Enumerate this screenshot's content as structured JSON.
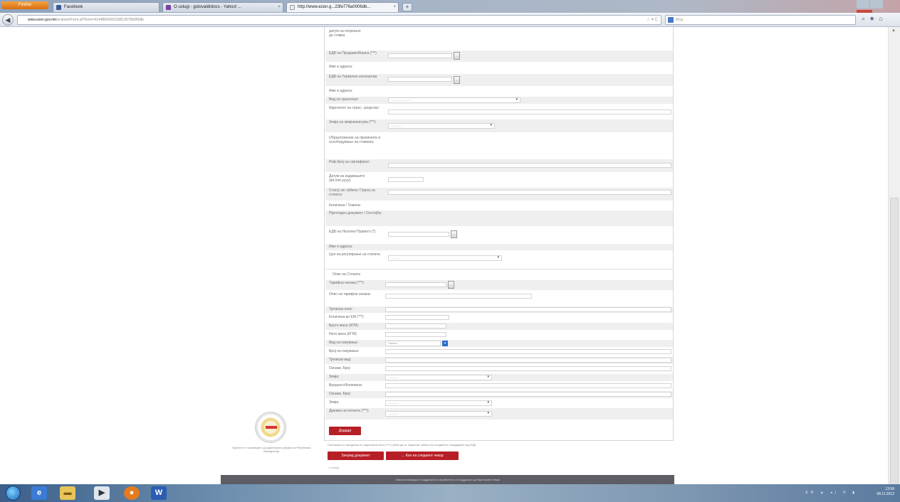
{
  "browser": {
    "menu_button": "Firefox",
    "tabs": [
      {
        "title": "Facebook",
        "active": false
      },
      {
        "title": "О uslugi - gotovaldrdocs - Yahoo! ...",
        "active": false
      },
      {
        "title": "http://www.ezen.g...23fe776a0006db...",
        "active": true
      }
    ],
    "new_tab": "+",
    "url_domain": "www.ezen.gov.mk",
    "url_path": "/ecitizen/Form.jsf?form=4144884266159813675b000db",
    "search_placeholder": "Bing"
  },
  "form": {
    "top_fragment": "датум на погрешно\nдо ставка",
    "rows": [
      {
        "label": "ЕДБ на Продавач/Банка (***)",
        "type": "lookup"
      },
      {
        "label": "Име и адреса:",
        "type": "static"
      },
      {
        "label": "ЕДБ на Термичко носилштва",
        "type": "lookup"
      },
      {
        "label": "Име и адреса:",
        "type": "static"
      },
      {
        "label": "Вид на транспорт:",
        "type": "select",
        "value": "----------------------"
      },
      {
        "label": "Идентитет на транс. средство:",
        "type": "text"
      },
      {
        "label": "Земја на земјоизнесува (***):",
        "type": "select",
        "value": "-----------"
      },
      {
        "label": "Образложение на промените и ослободување на ставката",
        "type": "static"
      },
      {
        "label": "Реф.број на сертификат:",
        "type": "text"
      },
      {
        "label": "Датум на издавањето (dd.mm.yyyy):",
        "type": "text"
      },
      {
        "label": "Статус во табела / Грана на стоката:",
        "type": "text"
      },
      {
        "label": "Количина / Тежина:",
        "type": "static"
      },
      {
        "label": "Претходен документ / Состојба:",
        "type": "static"
      },
      {
        "label": "ЕДБ на Носител Правото (*):",
        "type": "lookup"
      },
      {
        "label": "Име и адреса:",
        "type": "static"
      },
      {
        "label": "Цел на регулирање на стоката:",
        "type": "select",
        "value": "---------"
      }
    ],
    "section2_title": "Опис на Стоката",
    "rows2": [
      {
        "label": "Тарифна ознака (***):",
        "type": "lookup"
      },
      {
        "label": "Опис на тарифна ознака:",
        "type": "text"
      },
      {
        "label": "Трговски опис:",
        "type": "text"
      },
      {
        "label": "Количина во ЕМ (***):",
        "type": "text"
      },
      {
        "label": "Бруто маса (КГМ):",
        "type": "text"
      },
      {
        "label": "Нето маса (КГМ):",
        "type": "text"
      },
      {
        "label": "Вид на пакување:",
        "type": "select",
        "value": "Пакети"
      },
      {
        "label": "Број на пакувања:",
        "type": "text"
      },
      {
        "label": "Трговски вид:",
        "type": "text"
      },
      {
        "label": "Ознаки, Број:",
        "type": "text"
      },
      {
        "label": "Земја:",
        "type": "select",
        "value": "-----------"
      },
      {
        "label": "Вредност/Количина:",
        "type": "text"
      },
      {
        "label": "Ознаки, Број:",
        "type": "text"
      },
      {
        "label": "Земја:",
        "type": "select",
        "value": "-----------"
      },
      {
        "label": "Држава на потекло (***):",
        "type": "select",
        "value": "-----------"
      }
    ],
    "add_button": "Додади",
    "note": "Полињата со ѕвездичка се задолжителни и (***) треба да се поднесат записи во соодветен стандарден код ЕДБ",
    "submit_button": "Зачувај документ",
    "back_button": "← Кон на следниот чекор",
    "back_link": "« Назад"
  },
  "sidebar": {
    "logo_caption": "Проектот е спроведен од Царинската управа на Република Македонија"
  },
  "footer": {
    "text": "Оваа апликација е поддржана и изработена со поддршка од Европската Унија"
  },
  "taskbar": {
    "time": "13:58",
    "date": "08.11.2012",
    "tray": "EN ▲ ◂) ✆ ▮"
  }
}
